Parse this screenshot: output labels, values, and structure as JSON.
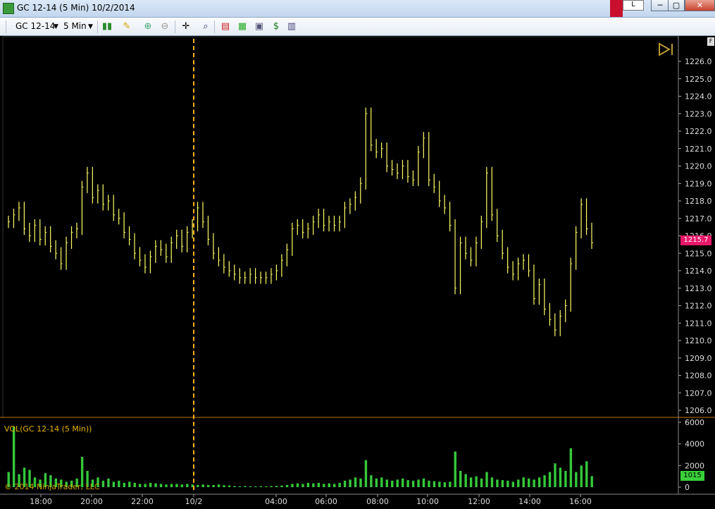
{
  "window": {
    "title": "GC 12-14 (5 Min)  10/2/2014",
    "link_label": "L",
    "min_glyph": "─",
    "max_glyph": "▢",
    "close_glyph": "✕"
  },
  "toolbar": {
    "instrument": "GC 12-14",
    "interval": "5 Min",
    "icons": [
      "chart-style-icon",
      "drawing-pencil-icon",
      "zoom-in-icon",
      "zoom-out-icon",
      "crosshair-icon",
      "search-icon",
      "indicators-icon",
      "strategies-icon",
      "properties-icon",
      "money-icon",
      "data-box-icon"
    ]
  },
  "price_panel": {
    "ticks": [
      "1226.0",
      "1225.0",
      "1224.0",
      "1223.0",
      "1222.0",
      "1221.0",
      "1220.0",
      "1219.0",
      "1218.0",
      "1217.0",
      "1216.0",
      "1215.0",
      "1214.0",
      "1213.0",
      "1212.0",
      "1211.0",
      "1210.0",
      "1209.0",
      "1208.0",
      "1207.0",
      "1206.0"
    ],
    "last_price": "1215.7"
  },
  "volume_panel": {
    "label": "VOL(GC 12-14 (5 Min))",
    "ticks": [
      "6000",
      "4000",
      "2000",
      "0"
    ],
    "last_volume": "1015"
  },
  "time_axis": [
    "18:00",
    "20:00",
    "22:00",
    "10/2",
    "04:00",
    "06:00",
    "08:00",
    "10:00",
    "12:00",
    "14:00",
    "16:00"
  ],
  "copyright": "© 2014 NinjaTrader, LLC",
  "colors": {
    "bars": "#ffff66",
    "volume": "#35c83a",
    "cursor": "#ffb21a",
    "price_tag": "#e8186a"
  },
  "chart_data": {
    "type": "bar",
    "title": "GC 12-14 (5 Min)",
    "ylim": [
      1206,
      1226
    ],
    "series": [
      {
        "close": [
          1216.8,
          1217.2,
          1217.6,
          1216.4,
          1216.0,
          1216.6,
          1215.8,
          1216.2,
          1215.4,
          1215.0,
          1214.4,
          1215.6,
          1216.2,
          1216.4,
          1218.8,
          1219.6,
          1218.2,
          1218.6,
          1217.8,
          1218.0,
          1217.2,
          1217.0,
          1216.2,
          1215.8,
          1215.0,
          1214.6,
          1214.2,
          1214.8,
          1215.4,
          1215.2,
          1214.8,
          1215.6,
          1216.0,
          1215.4,
          1216.2,
          1216.6,
          1217.6,
          1216.8,
          1215.8,
          1215.0,
          1214.6,
          1214.2,
          1214.0,
          1213.8,
          1213.6,
          1213.6,
          1213.8,
          1213.6,
          1213.6,
          1213.6,
          1213.8,
          1214.0,
          1214.6,
          1215.2,
          1216.4,
          1216.6,
          1216.2,
          1216.4,
          1216.8,
          1217.2,
          1216.6,
          1216.8,
          1216.6,
          1216.8,
          1217.6,
          1217.8,
          1218.2,
          1219.0,
          1223.0,
          1221.2,
          1220.8,
          1221.0,
          1220.0,
          1219.8,
          1219.6,
          1220.0,
          1219.4,
          1219.2,
          1220.8,
          1221.6,
          1219.2,
          1218.8,
          1218.0,
          1217.6,
          1216.6,
          1213.0,
          1215.6,
          1215.0,
          1214.6,
          1215.6,
          1216.8,
          1219.6,
          1217.2,
          1216.0,
          1215.0,
          1214.2,
          1213.8,
          1214.4,
          1214.6,
          1214.0,
          1212.4,
          1213.2,
          1211.8,
          1211.2,
          1210.6,
          1211.4,
          1212.0,
          1214.4,
          1216.2,
          1217.8,
          1216.4,
          1215.6
        ]
      },
      {
        "name": "VOL",
        "values": [
          1400,
          5600,
          1200,
          1800,
          1600,
          900,
          700,
          1300,
          1100,
          800,
          700,
          500,
          600,
          800,
          2800,
          1500,
          700,
          900,
          600,
          800,
          500,
          600,
          400,
          500,
          400,
          300,
          300,
          400,
          350,
          300,
          250,
          300,
          300,
          250,
          300,
          250,
          200,
          250,
          200,
          200,
          250,
          180,
          150,
          100,
          80,
          100,
          80,
          70,
          90,
          80,
          100,
          120,
          150,
          200,
          300,
          350,
          300,
          400,
          350,
          400,
          300,
          350,
          300,
          400,
          600,
          700,
          900,
          800,
          2500,
          1100,
          800,
          900,
          700,
          600,
          700,
          800,
          650,
          600,
          700,
          800,
          600,
          550,
          500,
          450,
          500,
          3300,
          1500,
          1200,
          900,
          1000,
          800,
          1400,
          900,
          700,
          650,
          600,
          500,
          700,
          900,
          800,
          700,
          900,
          1100,
          1400,
          2200,
          1800,
          1500,
          3600,
          1400,
          2000,
          2400,
          1015
        ]
      }
    ]
  }
}
